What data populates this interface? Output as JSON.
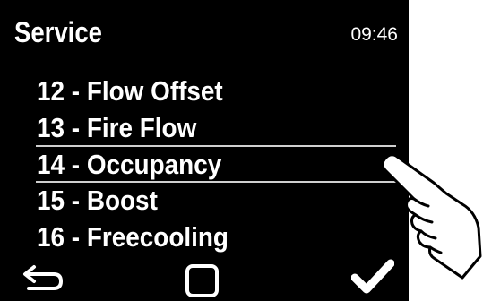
{
  "header": {
    "title": "Service",
    "time": "09:46"
  },
  "menu": {
    "items": [
      {
        "label": "12 - Flow Offset"
      },
      {
        "label": "13 - Fire Flow"
      },
      {
        "label": "14 - Occupancy"
      },
      {
        "label": "15 - Boost"
      },
      {
        "label": "16 - Freecooling"
      }
    ],
    "selected_index": 2
  },
  "footer": {
    "back_icon": "back-arrow-icon",
    "home_icon": "square-icon",
    "confirm_icon": "checkmark-icon"
  },
  "overlay": {
    "icon": "pointing-hand-icon"
  },
  "colors": {
    "screen_bg": "#000000",
    "text": "#ffffff",
    "selection_line": "#cfcfcf"
  }
}
